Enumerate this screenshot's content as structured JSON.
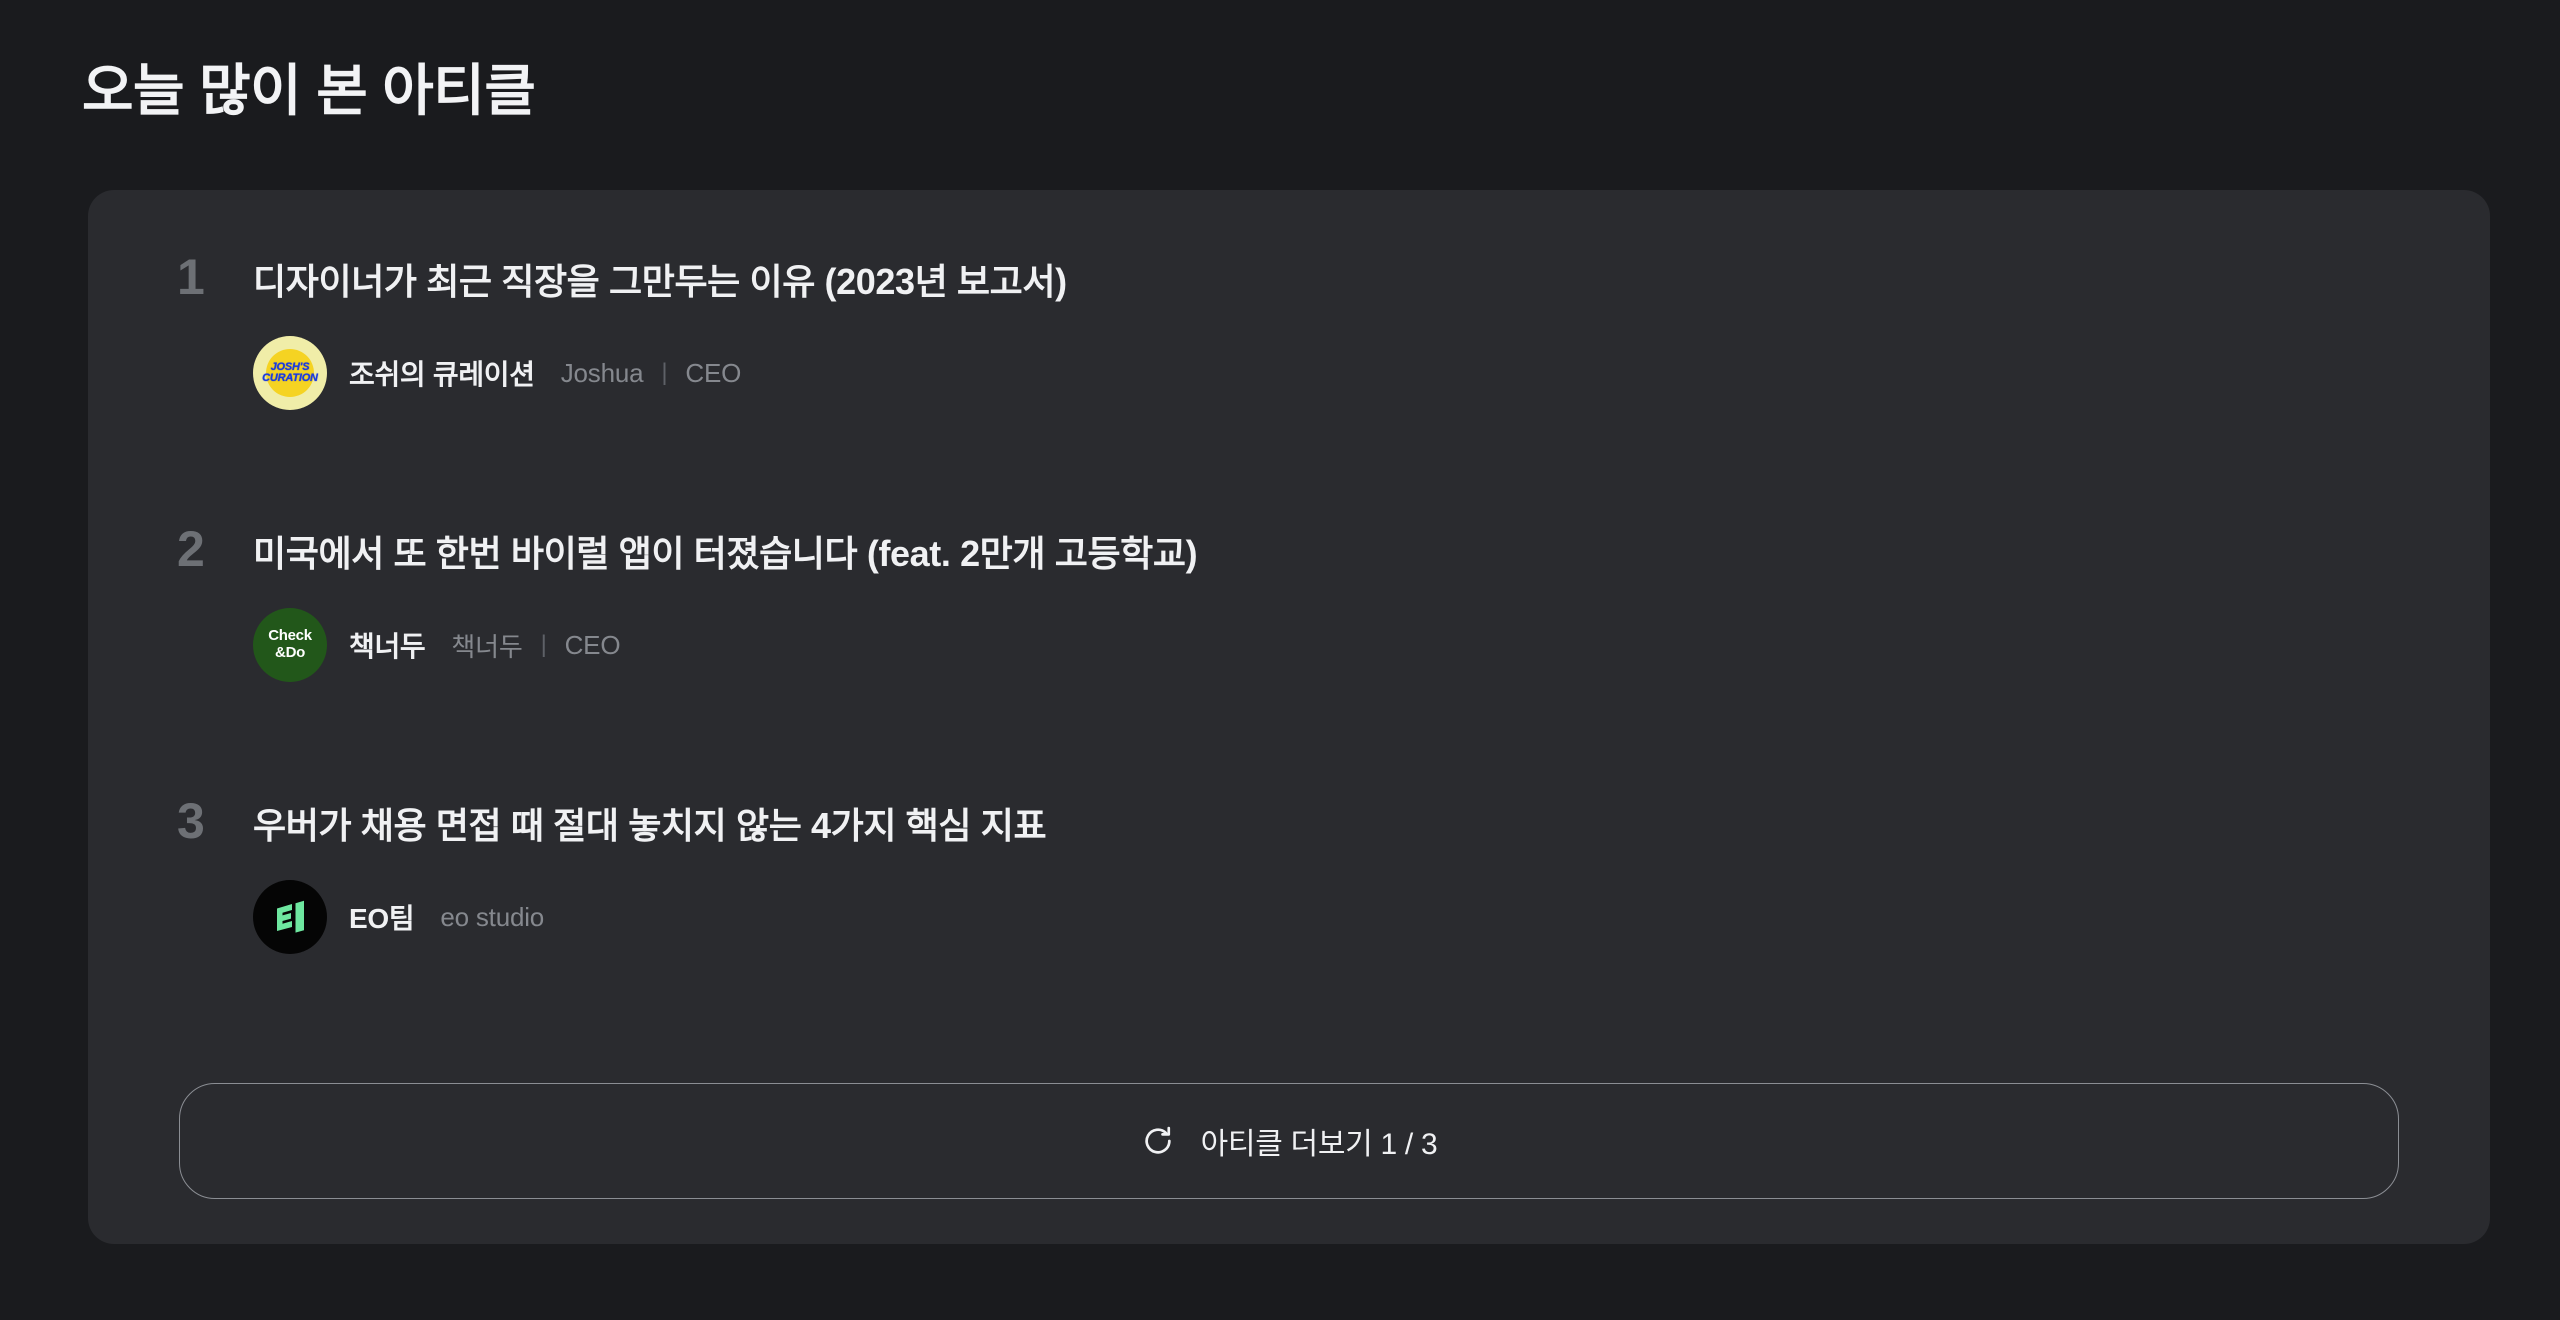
{
  "page": {
    "title": "오늘 많이 본 아티클",
    "background_color": "#1a1b1e",
    "card_background_color": "#2a2b2f"
  },
  "articles": [
    {
      "rank": "1",
      "title": "디자이너가 최근 직장을 그만두는 이유 (2023년 보고서)",
      "author_name": "조쉬의 큐레이션",
      "author_handle": "Joshua",
      "separator": "|",
      "author_role": "CEO",
      "avatar": {
        "icon": "joshs-curation-logo",
        "line1": "JOSH'S",
        "line2": "CURATION",
        "outer_color": "#f0eda8",
        "inner_color": "#f5d322",
        "text_color": "#1a3ae0"
      }
    },
    {
      "rank": "2",
      "title": "미국에서 또 한번 바이럴 앱이 터졌습니다 (feat. 2만개 고등학교)",
      "author_name": "책너두",
      "author_handle": "책너두",
      "separator": "|",
      "author_role": "CEO",
      "avatar": {
        "icon": "check-and-do-logo",
        "line1": "Check",
        "line2": "&Do",
        "outer_color": "#22571a",
        "text_color": "#ffffff"
      }
    },
    {
      "rank": "3",
      "title": "우버가 채용 면접 때 절대 놓치지 않는 4가지 핵심 지표",
      "author_name": "EO팀",
      "author_handle": "eo studio",
      "separator": "",
      "author_role": "",
      "avatar": {
        "icon": "eo-studio-logo",
        "outer_color": "#050505",
        "mark_color": "#6ee7a0"
      }
    }
  ],
  "more_button": {
    "icon": "refresh-icon",
    "label": "아티클 더보기 1 / 3",
    "page_current": "1",
    "page_total": "3",
    "border_color": "#8b8e94"
  }
}
